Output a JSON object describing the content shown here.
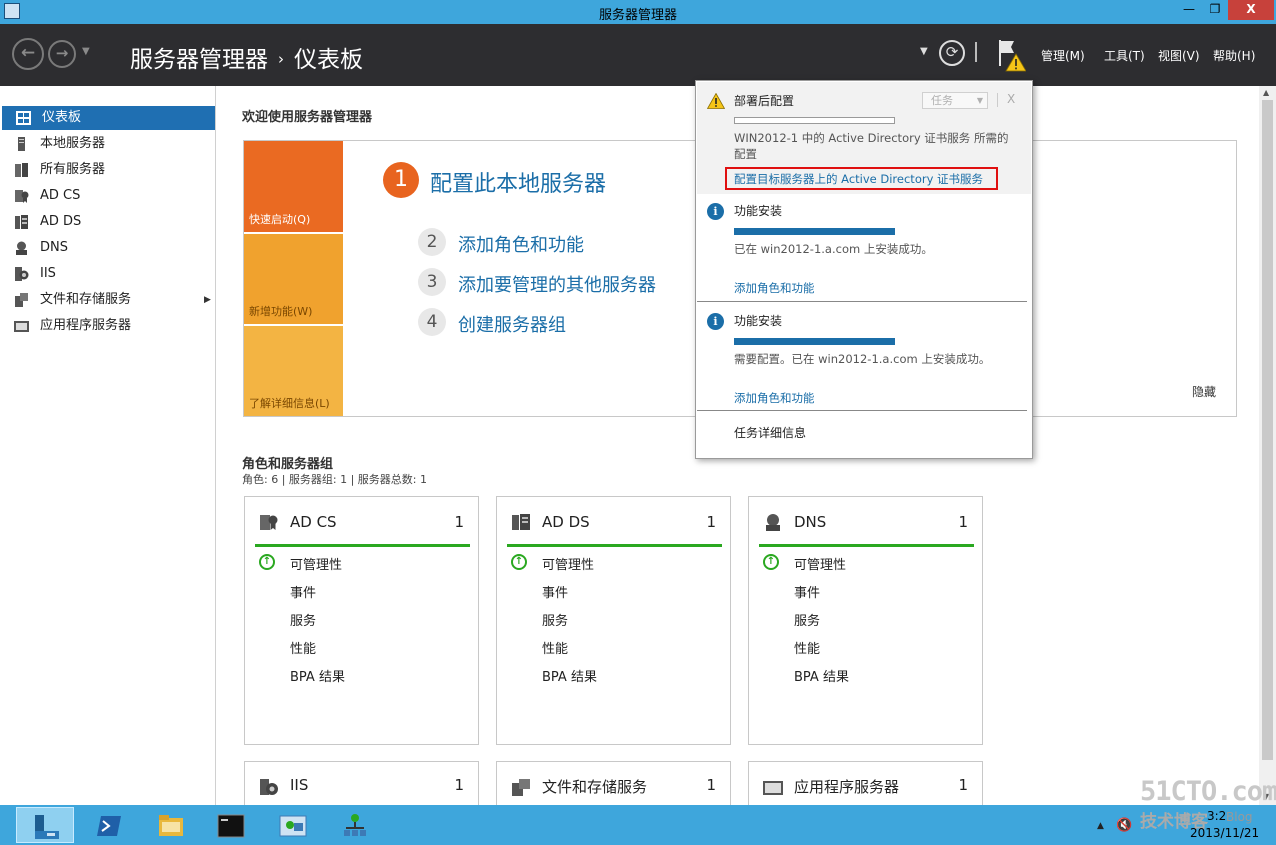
{
  "window": {
    "title": "服务器管理器",
    "min": "—",
    "max": "❐",
    "close": "X"
  },
  "header": {
    "breadcrumb_root": "服务器管理器",
    "breadcrumb_sep": "›",
    "breadcrumb_current": "仪表板",
    "menus": [
      "管理(M)",
      "工具(T)",
      "视图(V)",
      "帮助(H)"
    ]
  },
  "sidebar": {
    "items": [
      {
        "label": "仪表板",
        "active": true
      },
      {
        "label": "本地服务器"
      },
      {
        "label": "所有服务器"
      },
      {
        "label": "AD CS"
      },
      {
        "label": "AD DS"
      },
      {
        "label": "DNS"
      },
      {
        "label": "IIS"
      },
      {
        "label": "文件和存储服务",
        "expandable": true
      },
      {
        "label": "应用程序服务器"
      }
    ]
  },
  "welcome": {
    "title": "欢迎使用服务器管理器",
    "tiles": [
      "快速启动(Q)",
      "新增功能(W)",
      "了解详细信息(L)"
    ],
    "steps": [
      {
        "num": "1",
        "label": "配置此本地服务器"
      },
      {
        "num": "2",
        "label": "添加角色和功能"
      },
      {
        "num": "3",
        "label": "添加要管理的其他服务器"
      },
      {
        "num": "4",
        "label": "创建服务器组"
      }
    ],
    "hide": "隐藏"
  },
  "roles": {
    "title": "角色和服务器组",
    "subtitle": "角色: 6 | 服务器组: 1 | 服务器总数: 1",
    "row_labels": [
      "可管理性",
      "事件",
      "服务",
      "性能",
      "BPA 结果"
    ],
    "cards": [
      {
        "name": "AD CS",
        "count": "1"
      },
      {
        "name": "AD DS",
        "count": "1"
      },
      {
        "name": "DNS",
        "count": "1"
      },
      {
        "name": "IIS",
        "count": "1"
      },
      {
        "name": "文件和存储服务",
        "count": "1"
      },
      {
        "name": "应用程序服务器",
        "count": "1"
      }
    ]
  },
  "notifications": {
    "task_dropdown": "任务",
    "close": "X",
    "items": [
      {
        "title": "部署后配置",
        "text1": "WIN2012-1 中的 Active Directory 证书服务 所需的",
        "text2": "配置",
        "link": "配置目标服务器上的 Active Directory 证书服务"
      },
      {
        "title": "功能安装",
        "text1": "已在 win2012-1.a.com 上安装成功。",
        "link": "添加角色和功能"
      },
      {
        "title": "功能安装",
        "text1": "需要配置。已在 win2012-1.a.com 上安装成功。",
        "link": "添加角色和功能"
      }
    ],
    "task_details": "任务详细信息"
  },
  "taskbar": {
    "time": "3:2",
    "date": "2013/11/21"
  },
  "watermark": {
    "site": "51CTO.com",
    "tagline": "技术博客",
    "blog": "Blog"
  },
  "colors": {
    "titlebar": "#3ea6dc",
    "header": "#2d2d30",
    "accent": "#1b6ea8",
    "quickstart": "#ea6a22",
    "healthy": "#2aa820",
    "highlight": "#e01010"
  }
}
